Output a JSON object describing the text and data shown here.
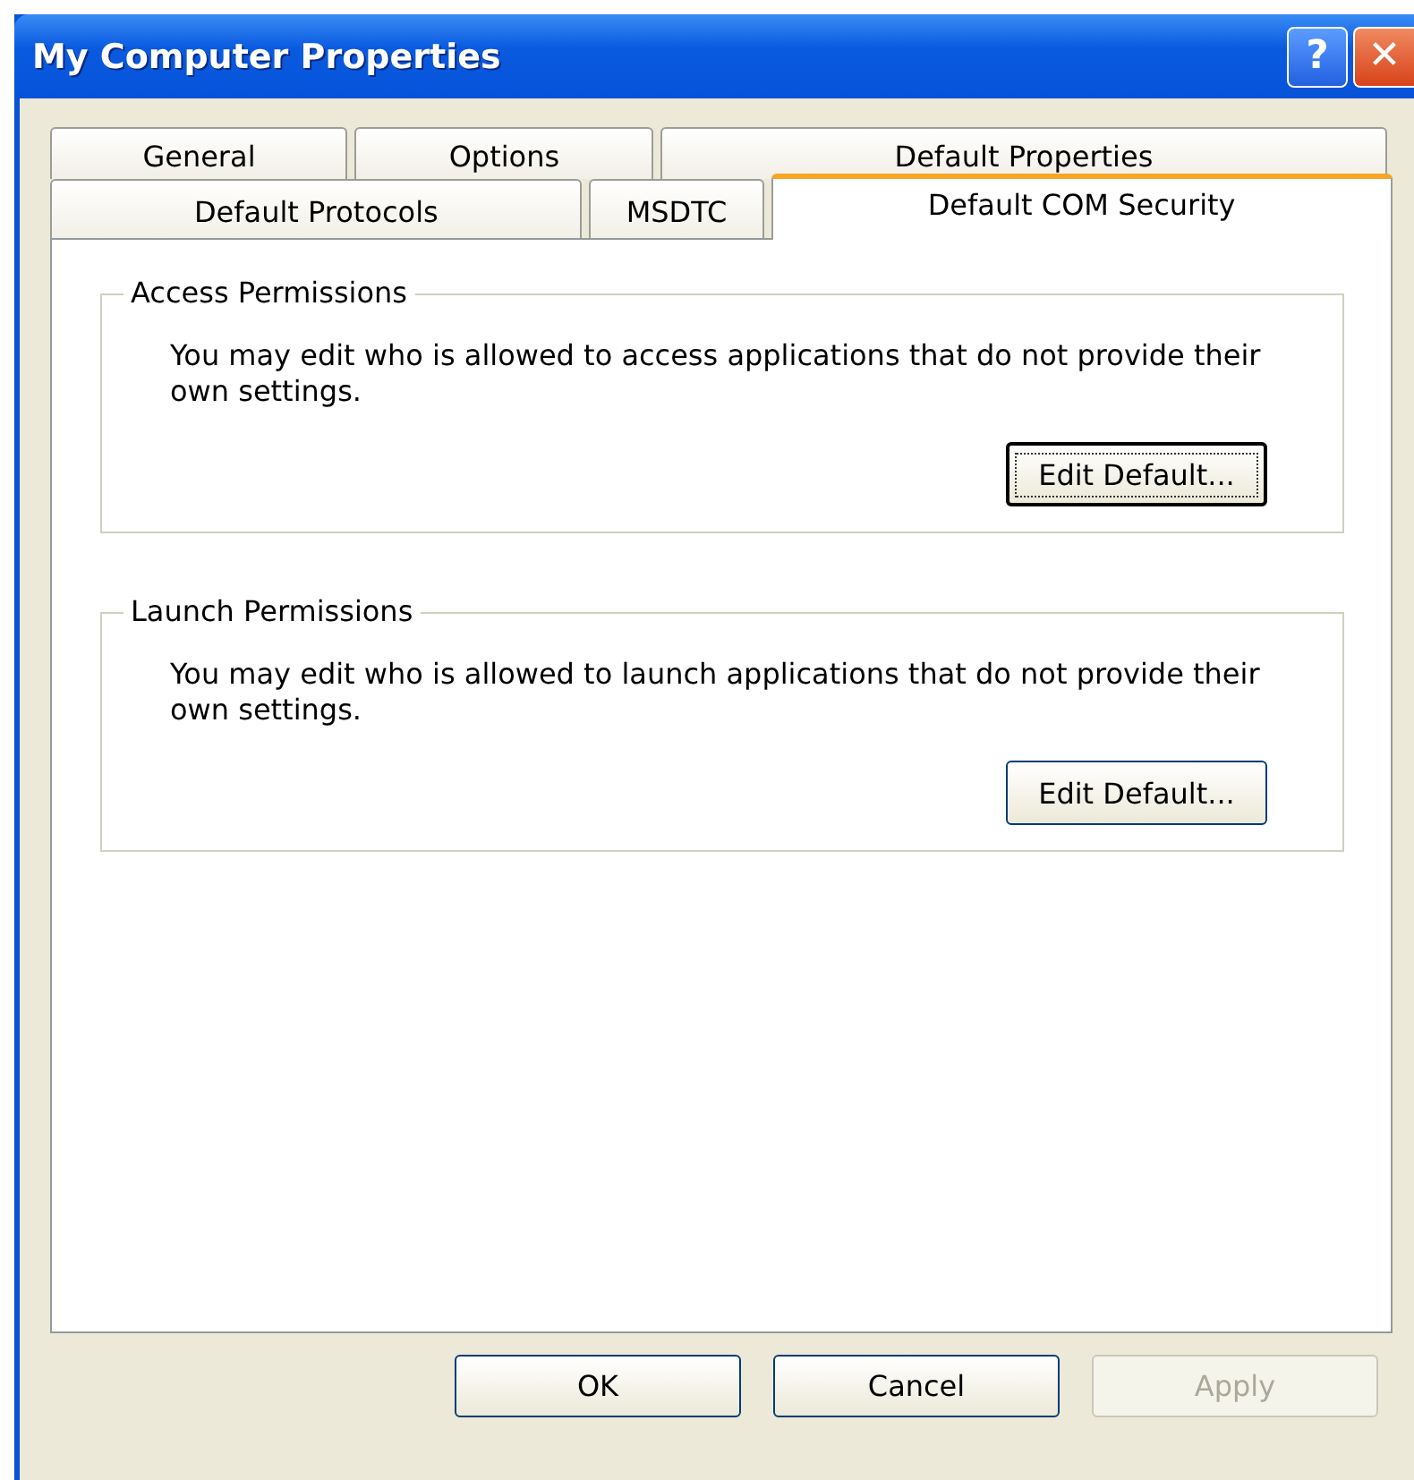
{
  "window": {
    "title": "My Computer Properties",
    "title_buttons": [
      {
        "kind": "help",
        "label": "?"
      },
      {
        "kind": "close",
        "label": "✕"
      }
    ]
  },
  "tab_rows": [
    [
      {
        "label": "General",
        "selected": false
      },
      {
        "label": "Options",
        "selected": false
      },
      {
        "label": "Default Properties",
        "selected": false
      }
    ],
    [
      {
        "label": "Default Protocols",
        "selected": false
      },
      {
        "label": "MSDTC",
        "selected": false
      },
      {
        "label": "Default COM Security",
        "selected": true
      }
    ]
  ],
  "groups": [
    {
      "title": "Access Permissions",
      "text": "You may edit who is allowed to access applications that do not provide their own settings.",
      "button": {
        "label": "Edit Default...",
        "focused": true
      }
    },
    {
      "title": "Launch Permissions",
      "text": "You may edit who is allowed to launch applications that do not provide their own settings.",
      "button": {
        "label": "Edit Default...",
        "focused": false
      }
    }
  ],
  "buttons": [
    {
      "label": "OK",
      "disabled": false
    },
    {
      "label": "Cancel",
      "disabled": false
    },
    {
      "label": "Apply",
      "disabled": true
    }
  ]
}
